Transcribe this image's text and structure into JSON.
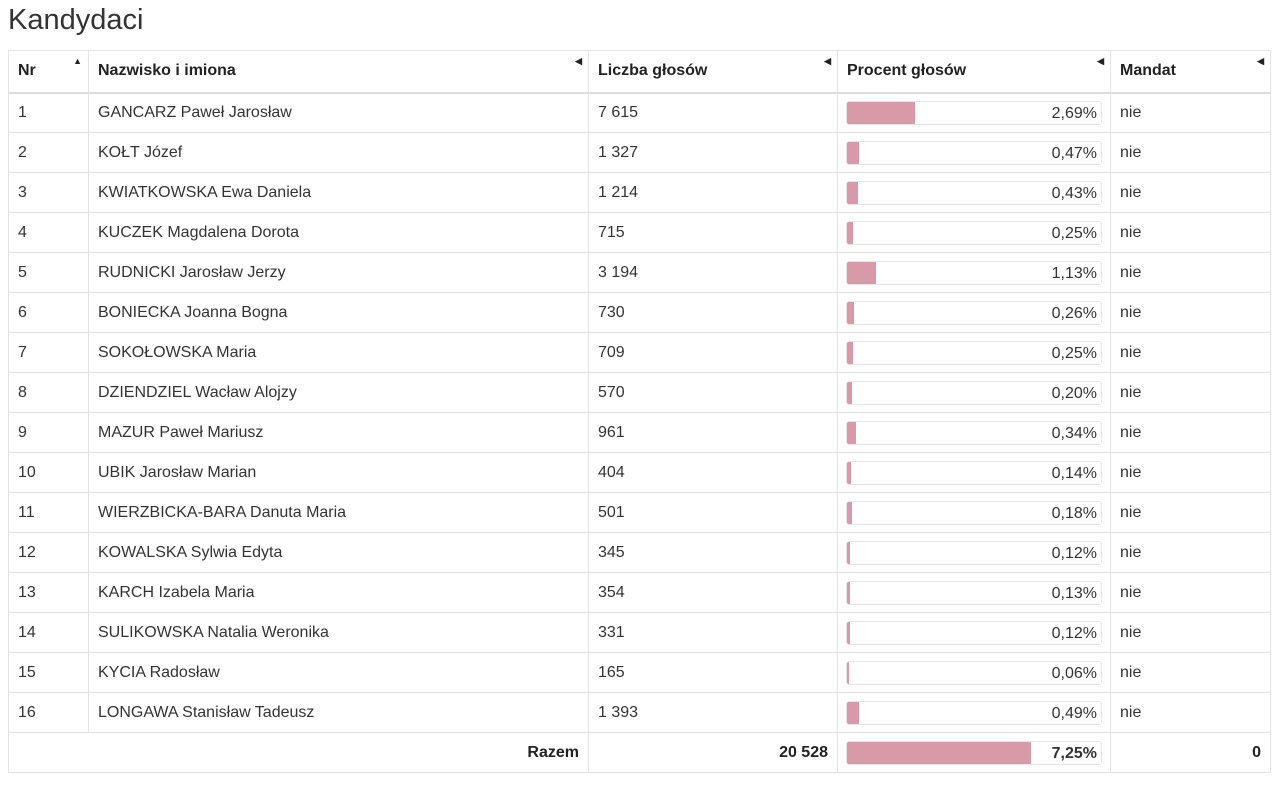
{
  "title": "Kandydaci",
  "columns": {
    "nr": "Nr",
    "name": "Nazwisko i imiona",
    "votes": "Liczba głosów",
    "percent": "Procent głosów",
    "mandate": "Mandat"
  },
  "colors": {
    "bar_fill": "#d89aa8"
  },
  "rows": [
    {
      "nr": "1",
      "name": "GANCARZ Paweł Jarosław",
      "votes": "7 615",
      "percent": "2,69%",
      "pct": 2.69,
      "mandate": "nie"
    },
    {
      "nr": "2",
      "name": "KOŁT Józef",
      "votes": "1 327",
      "percent": "0,47%",
      "pct": 0.47,
      "mandate": "nie"
    },
    {
      "nr": "3",
      "name": "KWIATKOWSKA Ewa Daniela",
      "votes": "1 214",
      "percent": "0,43%",
      "pct": 0.43,
      "mandate": "nie"
    },
    {
      "nr": "4",
      "name": "KUCZEK Magdalena Dorota",
      "votes": "715",
      "percent": "0,25%",
      "pct": 0.25,
      "mandate": "nie"
    },
    {
      "nr": "5",
      "name": "RUDNICKI Jarosław Jerzy",
      "votes": "3 194",
      "percent": "1,13%",
      "pct": 1.13,
      "mandate": "nie"
    },
    {
      "nr": "6",
      "name": "BONIECKA Joanna Bogna",
      "votes": "730",
      "percent": "0,26%",
      "pct": 0.26,
      "mandate": "nie"
    },
    {
      "nr": "7",
      "name": "SOKOŁOWSKA Maria",
      "votes": "709",
      "percent": "0,25%",
      "pct": 0.25,
      "mandate": "nie"
    },
    {
      "nr": "8",
      "name": "DZIENDZIEL Wacław Alojzy",
      "votes": "570",
      "percent": "0,20%",
      "pct": 0.2,
      "mandate": "nie"
    },
    {
      "nr": "9",
      "name": "MAZUR Paweł Mariusz",
      "votes": "961",
      "percent": "0,34%",
      "pct": 0.34,
      "mandate": "nie"
    },
    {
      "nr": "10",
      "name": "UBIK Jarosław Marian",
      "votes": "404",
      "percent": "0,14%",
      "pct": 0.14,
      "mandate": "nie"
    },
    {
      "nr": "11",
      "name": "WIERZBICKA-BARA Danuta Maria",
      "votes": "501",
      "percent": "0,18%",
      "pct": 0.18,
      "mandate": "nie"
    },
    {
      "nr": "12",
      "name": "KOWALSKA Sylwia Edyta",
      "votes": "345",
      "percent": "0,12%",
      "pct": 0.12,
      "mandate": "nie"
    },
    {
      "nr": "13",
      "name": "KARCH Izabela Maria",
      "votes": "354",
      "percent": "0,13%",
      "pct": 0.13,
      "mandate": "nie"
    },
    {
      "nr": "14",
      "name": "SULIKOWSKA Natalia Weronika",
      "votes": "331",
      "percent": "0,12%",
      "pct": 0.12,
      "mandate": "nie"
    },
    {
      "nr": "15",
      "name": "KYCIA Radosław",
      "votes": "165",
      "percent": "0,06%",
      "pct": 0.06,
      "mandate": "nie"
    },
    {
      "nr": "16",
      "name": "LONGAWA Stanisław Tadeusz",
      "votes": "1 393",
      "percent": "0,49%",
      "pct": 0.49,
      "mandate": "nie"
    }
  ],
  "total": {
    "label": "Razem",
    "votes": "20 528",
    "percent": "7,25%",
    "pct": 7.25,
    "mandate": "0"
  }
}
